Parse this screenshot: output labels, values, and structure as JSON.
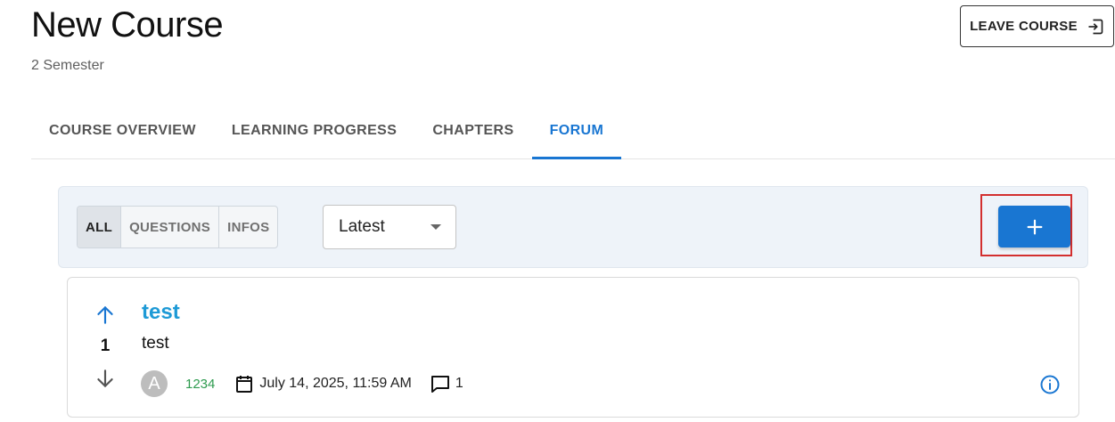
{
  "course": {
    "title": "New Course",
    "subtitle": "2 Semester",
    "leave_label": "LEAVE COURSE",
    "leave_icon": "logout-icon"
  },
  "tabs": [
    {
      "label": "COURSE OVERVIEW",
      "active": false
    },
    {
      "label": "LEARNING PROGRESS",
      "active": false
    },
    {
      "label": "CHAPTERS",
      "active": false
    },
    {
      "label": "FORUM",
      "active": true
    }
  ],
  "forum": {
    "filters": [
      {
        "label": "ALL",
        "active": true
      },
      {
        "label": "QUESTIONS",
        "active": false
      },
      {
        "label": "INFOS",
        "active": false
      }
    ],
    "sort": {
      "selected": "Latest"
    },
    "add_icon": "plus-icon"
  },
  "posts": [
    {
      "title": "test",
      "body": "test",
      "votes": "1",
      "avatar_letter": "A",
      "author": "1234",
      "date": "July 14, 2025, 11:59 AM",
      "comments": "1"
    }
  ],
  "colors": {
    "accent": "#1976d2",
    "post_title": "#1e9ad6",
    "author": "#2e9b4f",
    "highlight": "#d32f2f"
  }
}
